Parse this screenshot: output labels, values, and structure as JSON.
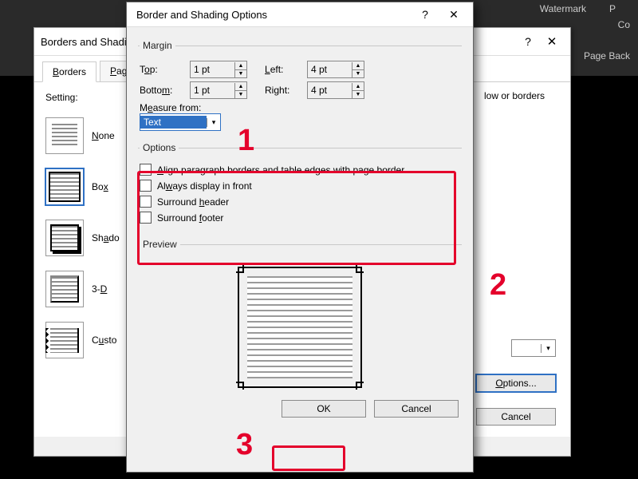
{
  "ribbon": {
    "watermark": "Watermark",
    "p": "P",
    "co": "Co",
    "pageback": "Page Back"
  },
  "bg_dialog": {
    "title": "Borders and Shading",
    "help": "?",
    "close": "✕",
    "tabs": {
      "borders": "Borders",
      "page": "Page Border"
    },
    "setting_label": "Setting:",
    "settings": {
      "none": "None",
      "box": "Box",
      "shadow": "Shadow",
      "threeD": "3-D",
      "custom": "Custom"
    },
    "right_hint": "low or borders",
    "apply_combo_arrow": "⌄",
    "options_btn": "Options...",
    "cancel_btn": "Cancel"
  },
  "fg_dialog": {
    "title": "Border and Shading Options",
    "help": "?",
    "close": "✕",
    "margin_legend": "Margin",
    "top_label": "Top:",
    "bottom_label": "Bottom:",
    "left_label": "Left:",
    "right_label": "Right:",
    "top_value": "1 pt",
    "bottom_value": "1 pt",
    "left_value": "4 pt",
    "right_value": "4 pt",
    "measure_label": "Measure from:",
    "measure_value": "Text",
    "options_legend": "Options",
    "opt_align": "Align paragraph borders and table edges with page border",
    "opt_front": "Always display in front",
    "opt_header": "Surround header",
    "opt_footer": "Surround footer",
    "preview_legend": "Preview",
    "ok_btn": "OK",
    "cancel_btn": "Cancel"
  },
  "callouts": {
    "n1": "1",
    "n2": "2",
    "n3": "3"
  }
}
